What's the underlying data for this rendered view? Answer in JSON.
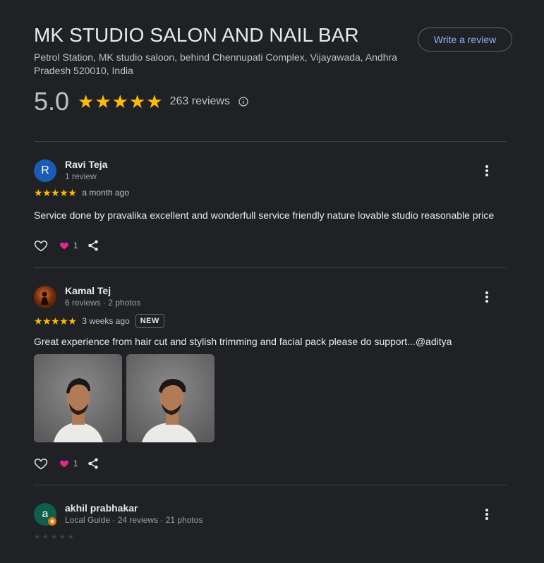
{
  "business": {
    "name": "MK STUDIO SALON AND NAIL BAR",
    "address": "Petrol Station, MK studio saloon, behind Chennupati Complex, Vijayawada, Andhra Pradesh 520010, India",
    "write_review_label": "Write a review",
    "rating": "5.0",
    "stars": 5,
    "review_count": "263 reviews"
  },
  "colors": {
    "star": "#fbbc04",
    "link": "#8ab4f8",
    "heart": "#e52592"
  },
  "reviews": [
    {
      "initial": "R",
      "avatar_color": "#1a5bb5",
      "name": "Ravi Teja",
      "meta": "1 review",
      "stars": 5,
      "date": "a month ago",
      "text": "Service done by pravalika excellent and wonderfull service friendly nature lovable studio reasonable price",
      "reaction_count": "1"
    },
    {
      "initial": "",
      "avatar_color": "#3b1d0e",
      "name": "Kamal Tej",
      "meta": "6 reviews · 2 photos",
      "stars": 5,
      "date": "3 weeks ago",
      "badge": "NEW",
      "text": "Great experience from hair cut and stylish trimming and facial pack please do support...@aditya",
      "reaction_count": "1"
    },
    {
      "initial": "a",
      "avatar_color": "#0f5e4b",
      "name": "akhil prabhakar",
      "meta": "Local Guide · 24 reviews · 21 photos"
    }
  ]
}
